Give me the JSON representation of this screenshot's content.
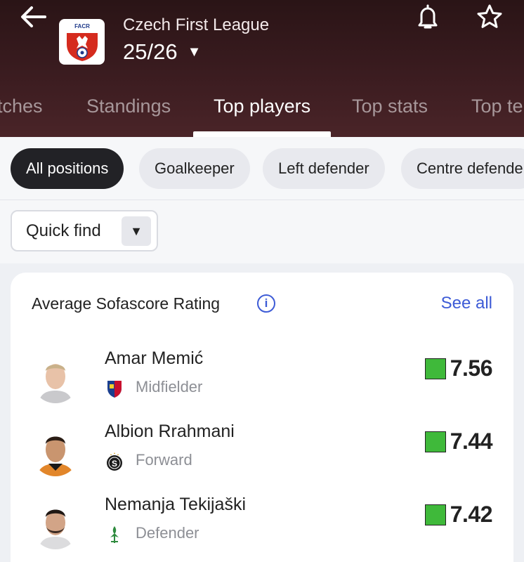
{
  "header": {
    "league_name": "Czech First League",
    "season": "25/26",
    "logo_text": "FACR",
    "icons": [
      "back-arrow-icon",
      "bell-icon",
      "star-icon",
      "chevron-down-icon"
    ]
  },
  "tabs": [
    {
      "label": "tches",
      "active": false
    },
    {
      "label": "Standings",
      "active": false
    },
    {
      "label": "Top players",
      "active": true
    },
    {
      "label": "Top stats",
      "active": false
    },
    {
      "label": "Top te",
      "active": false
    }
  ],
  "filters": [
    {
      "label": "All positions",
      "active": true
    },
    {
      "label": "Goalkeeper",
      "active": false
    },
    {
      "label": "Left defender",
      "active": false
    },
    {
      "label": "Centre defende",
      "active": false
    }
  ],
  "quick_find": {
    "label": "Quick find"
  },
  "card": {
    "title": "Average Sofascore Rating",
    "see_all": "See all",
    "players": [
      {
        "name": "Amar Memić",
        "position": "Midfielder",
        "rating": "7.56",
        "team_icon": "viktoria-plzen-crest-icon"
      },
      {
        "name": "Albion Rrahmani",
        "position": "Forward",
        "rating": "7.44",
        "team_icon": "sparta-praha-crest-icon"
      },
      {
        "name": "Nemanja Tekijaški",
        "position": "Defender",
        "rating": "7.42",
        "team_icon": "bohemians-crest-icon"
      }
    ],
    "rating_color": "#3fb93a",
    "accent_color": "#3d5bd6"
  }
}
